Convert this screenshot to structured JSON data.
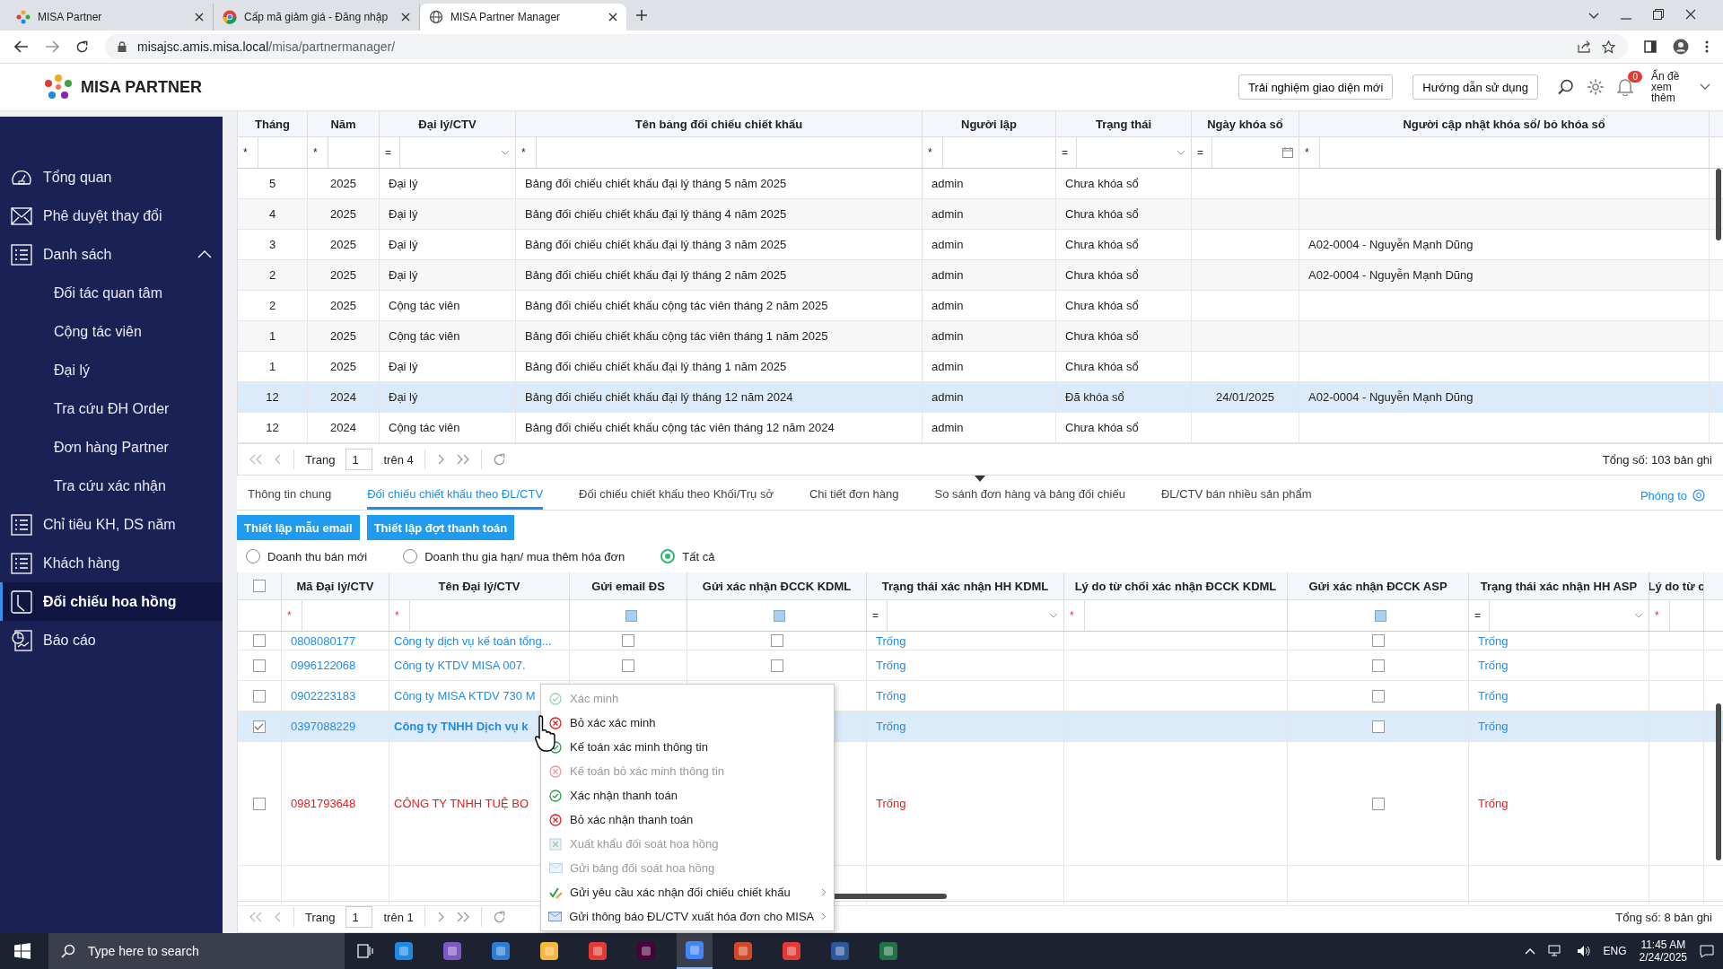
{
  "browser": {
    "tabs": [
      {
        "title": "MISA Partner",
        "selected": false
      },
      {
        "title": "Cấp mã giảm giá - Đăng nhập",
        "selected": false
      },
      {
        "title": "MISA Partner Manager",
        "selected": true
      }
    ],
    "url_host": "misajsc.amis.misa.local",
    "url_path": "/misa/partnermanager/"
  },
  "header": {
    "logo": "MISA PARTNER",
    "buttons": [
      "Trải nghiệm giao diện mới",
      "Hướng dẫn sử dụng"
    ],
    "notification_count": "0",
    "user_label": "Ẩn đề xem thêm"
  },
  "sidebar": {
    "items": [
      {
        "label": "Tổng quan",
        "selected": false
      },
      {
        "label": "Phê duyệt thay đổi",
        "selected": false
      },
      {
        "label": "Danh sách",
        "selected": false,
        "expanded": true,
        "children": [
          {
            "label": "Đối tác quan tâm",
            "selected": false
          },
          {
            "label": "Cộng tác viên",
            "selected": false
          },
          {
            "label": "Đại lý",
            "selected": false
          },
          {
            "label": "Tra cứu ĐH Order",
            "selected": false
          },
          {
            "label": "Đơn hàng Partner",
            "selected": false
          },
          {
            "label": "Tra cứu xác nhận",
            "selected": false
          }
        ]
      },
      {
        "label": "Chỉ tiêu KH, DS năm",
        "selected": false
      },
      {
        "label": "Khách hàng",
        "selected": false
      },
      {
        "label": "Đối chiếu hoa hồng",
        "selected": true
      },
      {
        "label": "Báo cáo",
        "selected": false
      }
    ]
  },
  "top_table": {
    "columns": [
      {
        "label": "Tháng",
        "filter_op": "*",
        "kind": "text"
      },
      {
        "label": "Năm",
        "filter_op": "*",
        "kind": "text"
      },
      {
        "label": "Đại lý/CTV",
        "filter_op": "=",
        "kind": "select"
      },
      {
        "label": "Tên bảng đối chiếu chiết khấu",
        "filter_op": "*",
        "kind": "text"
      },
      {
        "label": "Người lập",
        "filter_op": "*",
        "kind": "text"
      },
      {
        "label": "Trạng thái",
        "filter_op": "=",
        "kind": "select"
      },
      {
        "label": "Ngày khóa sổ",
        "filter_op": "=",
        "kind": "date"
      },
      {
        "label": "Người cập nhật khóa sổ/ bỏ khóa sổ",
        "filter_op": "*",
        "kind": "text"
      }
    ],
    "rows": [
      {
        "selected": false,
        "cells": [
          "5",
          "2025",
          "Đại lý",
          "Bảng đối chiếu chiết khấu đại lý tháng 5 năm 2025",
          "admin",
          "Chưa khóa sổ",
          "",
          ""
        ]
      },
      {
        "selected": false,
        "cells": [
          "4",
          "2025",
          "Đại lý",
          "Bảng đối chiếu chiết khấu đại lý tháng 4 năm 2025",
          "admin",
          "Chưa khóa sổ",
          "",
          ""
        ]
      },
      {
        "selected": false,
        "cells": [
          "3",
          "2025",
          "Đại lý",
          "Bảng đối chiếu chiết khấu đại lý tháng 3 năm 2025",
          "admin",
          "Chưa khóa sổ",
          "",
          "A02-0004 - Nguyễn Mạnh Dũng"
        ]
      },
      {
        "selected": false,
        "cells": [
          "2",
          "2025",
          "Đại lý",
          "Bảng đối chiếu chiết khấu đại lý tháng 2 năm 2025",
          "admin",
          "Chưa khóa sổ",
          "",
          "A02-0004 - Nguyễn Mạnh Dũng"
        ]
      },
      {
        "selected": false,
        "cells": [
          "2",
          "2025",
          "Cộng tác viên",
          "Bảng đối chiếu chiết khấu cộng tác viên tháng 2 năm 2025",
          "admin",
          "Chưa khóa sổ",
          "",
          ""
        ]
      },
      {
        "selected": false,
        "cells": [
          "1",
          "2025",
          "Cộng tác viên",
          "Bảng đối chiếu chiết khấu cộng tác viên tháng 1 năm 2025",
          "admin",
          "Chưa khóa sổ",
          "",
          ""
        ]
      },
      {
        "selected": false,
        "cells": [
          "1",
          "2025",
          "Đại lý",
          "Bảng đối chiếu chiết khấu đại lý tháng 1 năm 2025",
          "admin",
          "Chưa khóa sổ",
          "",
          ""
        ]
      },
      {
        "selected": true,
        "cells": [
          "12",
          "2024",
          "Đại lý",
          "Bảng đối chiếu chiết khấu đại lý tháng 12 năm 2024",
          "admin",
          "Đã khóa sổ",
          "24/01/2025",
          "A02-0004 - Nguyễn Mạnh Dũng"
        ]
      },
      {
        "selected": false,
        "cells": [
          "12",
          "2024",
          "Cộng tác viên",
          "Bảng đối chiếu chiết khấu cộng tác viên tháng 12 năm 2024",
          "admin",
          "Chưa khóa sổ",
          "",
          ""
        ]
      }
    ],
    "pager": {
      "page_label": "Trang",
      "page": "1",
      "of": "trên 4",
      "total": "Tổng số: 103 bản ghi"
    }
  },
  "tabs": [
    {
      "label": "Thông tin chung",
      "selected": false
    },
    {
      "label": "Đối chiếu chiết khấu theo ĐL/CTV",
      "selected": true
    },
    {
      "label": "Đối chiếu chiết khấu theo Khối/Trụ sở",
      "selected": false
    },
    {
      "label": "Chi tiết đơn hàng",
      "selected": false
    },
    {
      "label": "So sánh đơn hàng và bảng đối chiếu",
      "selected": false
    },
    {
      "label": "ĐL/CTV bán nhiều sản phẩm",
      "selected": false
    }
  ],
  "zoom_link": "Phóng to",
  "action_buttons": [
    "Thiết lập mẫu email",
    "Thiết lập đợt thanh toán"
  ],
  "revenue_filters": [
    {
      "label": "Doanh thu bán mới",
      "selected": false
    },
    {
      "label": "Doanh thu gia hạn/ mua thêm hóa đơn",
      "selected": false
    },
    {
      "label": "Tất cả",
      "selected": true
    }
  ],
  "detail_table": {
    "header_checked": false,
    "columns": [
      {
        "label": "Mã Đại lý/CTV",
        "kind": "text",
        "filter_op": "*"
      },
      {
        "label": "Tên Đại lý/CTV",
        "kind": "text",
        "filter_op": "*"
      },
      {
        "label": "Gửi email ĐS",
        "kind": "checkbox",
        "filter_checked": true
      },
      {
        "label": "Gửi xác nhận ĐCCK KDML",
        "kind": "checkbox",
        "filter_checked": true
      },
      {
        "label": "Trạng thái xác nhận HH KDML",
        "kind": "select",
        "filter_op": "="
      },
      {
        "label": "Lý do từ chối xác nhận ĐCCK KDML",
        "kind": "text",
        "filter_op": "*"
      },
      {
        "label": "Gửi xác nhận ĐCCK ASP",
        "kind": "checkbox",
        "filter_checked": true
      },
      {
        "label": "Trạng thái xác nhận HH ASP",
        "kind": "select",
        "filter_op": "="
      },
      {
        "label": "Lý do từ c",
        "kind": "text",
        "filter_op": "*"
      }
    ],
    "rows": [
      {
        "selected": false,
        "warning": false,
        "code": "0808080177",
        "name": "Công ty dịch vụ kế toán tổng...",
        "email_sent": false,
        "kdml_sent": false,
        "kdml_status": "Trống",
        "asp_sent": false,
        "asp_status": "Trống"
      },
      {
        "selected": false,
        "warning": false,
        "code": "0996122068",
        "name": "Công ty KTDV MISA 007.",
        "email_sent": false,
        "kdml_sent": false,
        "kdml_status": "Trống",
        "asp_sent": false,
        "asp_status": "Trống"
      },
      {
        "selected": false,
        "warning": false,
        "code": "0902223183",
        "name": "Công ty MISA KTDV 730 M",
        "kdml_status": "Trống",
        "asp_sent": false,
        "asp_status": "Trống"
      },
      {
        "selected": true,
        "warning": false,
        "code": "0397088229",
        "name": "Công ty TNHH Dịch vụ k",
        "kdml_status": "Trống",
        "asp_sent": false,
        "asp_status": "Trống"
      },
      {
        "selected": false,
        "warning": true,
        "code": "0981793648",
        "name": "CÔNG TY TNHH TUỆ BO",
        "kdml_status": "Trống",
        "asp_sent": false,
        "asp_status": "Trống"
      }
    ],
    "pager": {
      "page_label": "Trang",
      "page": "1",
      "of": "trên 1",
      "total": "Tổng số: 8 bản ghi"
    }
  },
  "context_menu": {
    "items": [
      {
        "label": "Xác minh",
        "disabled": true,
        "submenu": false
      },
      {
        "label": "Bỏ xác xác minh",
        "disabled": false,
        "submenu": false
      },
      {
        "label": "Kế toán xác minh thông tin",
        "disabled": false,
        "submenu": false
      },
      {
        "label": "Kế toán bỏ xác minh thông tin",
        "disabled": true,
        "submenu": false
      },
      {
        "label": "Xác nhận thanh toán",
        "disabled": false,
        "submenu": false
      },
      {
        "label": "Bỏ xác nhận thanh toán",
        "disabled": false,
        "submenu": false
      },
      {
        "label": "Xuất khẩu đối soát hoa hồng",
        "disabled": true,
        "submenu": false
      },
      {
        "label": "Gửi bảng đối soát hoa hồng",
        "disabled": true,
        "submenu": false
      },
      {
        "label": "Gửi yêu cầu xác nhận đối chiếu chiết khấu",
        "disabled": false,
        "submenu": true
      },
      {
        "label": "Gửi thông báo ĐL/CTV xuất hóa đơn cho MISA",
        "disabled": false,
        "submenu": true
      }
    ]
  },
  "taskbar": {
    "search_placeholder": "Type here to search",
    "language": "ENG",
    "time": "11:45 AM",
    "date": "2/24/2025"
  }
}
